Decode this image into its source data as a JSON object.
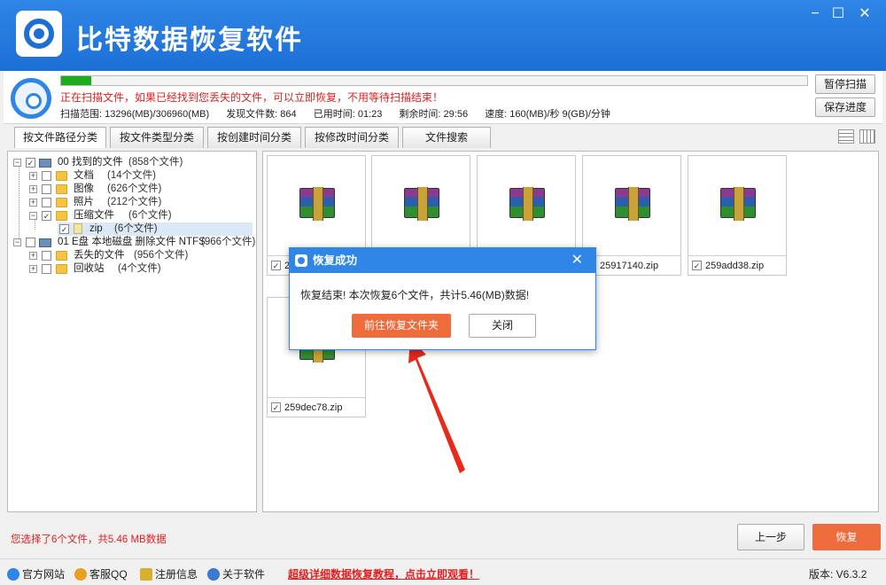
{
  "window": {
    "title": "比特数据恢复软件",
    "min_icon": "−",
    "max_icon": "☐",
    "close_icon": "✕"
  },
  "scan": {
    "progress_fraction": 0.04,
    "message": "正在扫描文件，如果已经找到您丢失的文件，可以立即恢复，不用等待扫描结束！",
    "range": "扫描范围: 13296(MB)/306960(MB)",
    "found": "发现文件数: 864",
    "elapsed": "已用时间: 01:23",
    "remaining": "剩余时间: 29:56",
    "speed": "速度: 160(MB)/秒  9(GB)/分钟",
    "pause_label": "暂停扫描",
    "save_label": "保存进度"
  },
  "tabs": [
    "按文件路径分类",
    "按文件类型分类",
    "按创建时间分类",
    "按修改时间分类",
    "文件搜索"
  ],
  "tree": [
    {
      "label": "00 找到的文件",
      "count": "(858个文件)"
    },
    {
      "label": "文档",
      "count": "(14个文件)"
    },
    {
      "label": "图像",
      "count": "(626个文件)"
    },
    {
      "label": "照片",
      "count": "(212个文件)"
    },
    {
      "label": "压缩文件",
      "count": "(6个文件)"
    },
    {
      "label": "zip",
      "count": "(6个文件)"
    },
    {
      "label": "01 E盘 本地磁盘 删除文件 NTFS",
      "count": "(966个文件)"
    },
    {
      "label": "丢失的文件",
      "count": "(956个文件)"
    },
    {
      "label": "回收站",
      "count": "(4个文件)"
    }
  ],
  "files": [
    {
      "name": "2"
    },
    {
      "name": ""
    },
    {
      "name": ""
    },
    {
      "name": "25917140.zip"
    },
    {
      "name": "259add38.zip"
    },
    {
      "name": "259dec78.zip"
    }
  ],
  "dialog": {
    "title": "恢复成功",
    "message": "恢复结束! 本次恢复6个文件，共计5.46(MB)数据!",
    "open_folder_label": "前往恢复文件夹",
    "close_label": "关闭",
    "close_icon": "✕"
  },
  "bottom": {
    "selection": "您选择了6个文件，共5.46 MB数据",
    "prev_label": "上一步",
    "recover_label": "恢复"
  },
  "footer": {
    "official_site": "官方网站",
    "support_qq": "客服QQ",
    "register": "注册信息",
    "about": "关于软件",
    "tutorial": "超级详细数据恢复教程，点击立即观看！",
    "version": "版本:  V6.3.2"
  },
  "colors": {
    "brand_blue": "#2f86e6",
    "accent_orange": "#ee6b3b",
    "alert_red": "#e02020",
    "progress_green": "#1faa1f"
  }
}
